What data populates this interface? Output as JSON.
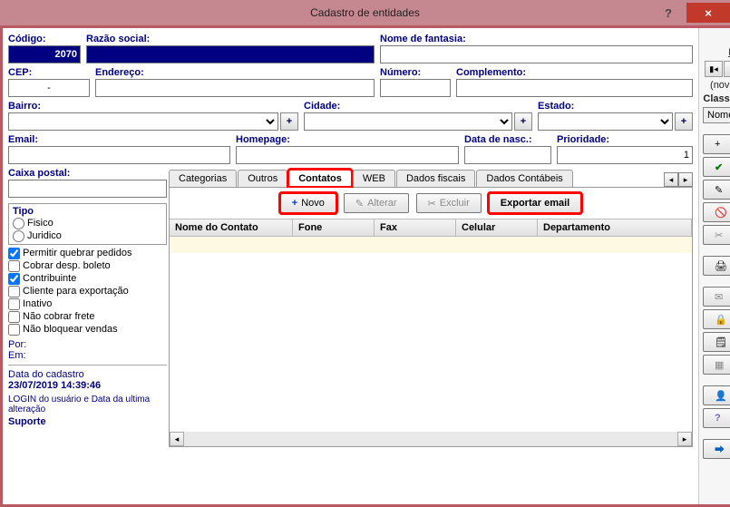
{
  "window": {
    "title": "Cadastro de entidades"
  },
  "labels": {
    "codigo": "Código:",
    "razao": "Razão social:",
    "fantasia": "Nome de fantasia:",
    "cep": "CEP:",
    "endereco": "Endereço:",
    "numero": "Número:",
    "complemento": "Complemento:",
    "bairro": "Bairro:",
    "cidade": "Cidade:",
    "estado": "Estado:",
    "email": "Email:",
    "homepage": "Homepage:",
    "datanasc": "Data de nasc.:",
    "prioridade": "Prioridade:",
    "caixa": "Caixa postal:",
    "tipo": "Tipo",
    "fisico": "Fisico",
    "juridico": "Juridico",
    "chk1": "Permitir quebrar pedidos",
    "chk2": "Cobrar desp. boleto",
    "chk3": "Contribuinte",
    "chk4": "Cliente para exportação",
    "chk5": "Inativo",
    "chk6": "Não cobrar frete",
    "chk7": "Não bloquear vendas",
    "por": "Por:",
    "em": "Em:",
    "datacad": "Data do cadastro",
    "datacad_val": "23/07/2019 14:39:46",
    "login_info": "LOGIN do usuário e Data da ultima alteração",
    "suporte": "Suporte"
  },
  "values": {
    "codigo": "2070",
    "cep": "-",
    "prioridade": "1"
  },
  "tabs": [
    "Categorias",
    "Outros",
    "Contatos",
    "WEB",
    "Dados fiscais",
    "Dados Contábeis"
  ],
  "subbar": {
    "novo": "Novo",
    "alterar": "Alterar",
    "excluir": "Excluir",
    "exportar": "Exportar email"
  },
  "grid": {
    "cols": [
      "Nome do Contato",
      "Fone",
      "Fax",
      "Celular",
      "Departamento"
    ]
  },
  "side": {
    "busca": "Busca",
    "novo_reg": "(novo registro)",
    "class": "Classificado Por",
    "class_val": "Nome",
    "novo": "Novo",
    "gravar": "Gravar",
    "alterar": "Alterar",
    "cancelar": "Cancelar",
    "excluir": "Excluir",
    "relatorios": "Relatórios",
    "email": "Email",
    "bloquear": "Bloquear",
    "nota": "Nota",
    "tabprecos": "Tab preços",
    "perfil": "Perfil...",
    "ajuda": "Ajuda",
    "sair": "Sair"
  }
}
